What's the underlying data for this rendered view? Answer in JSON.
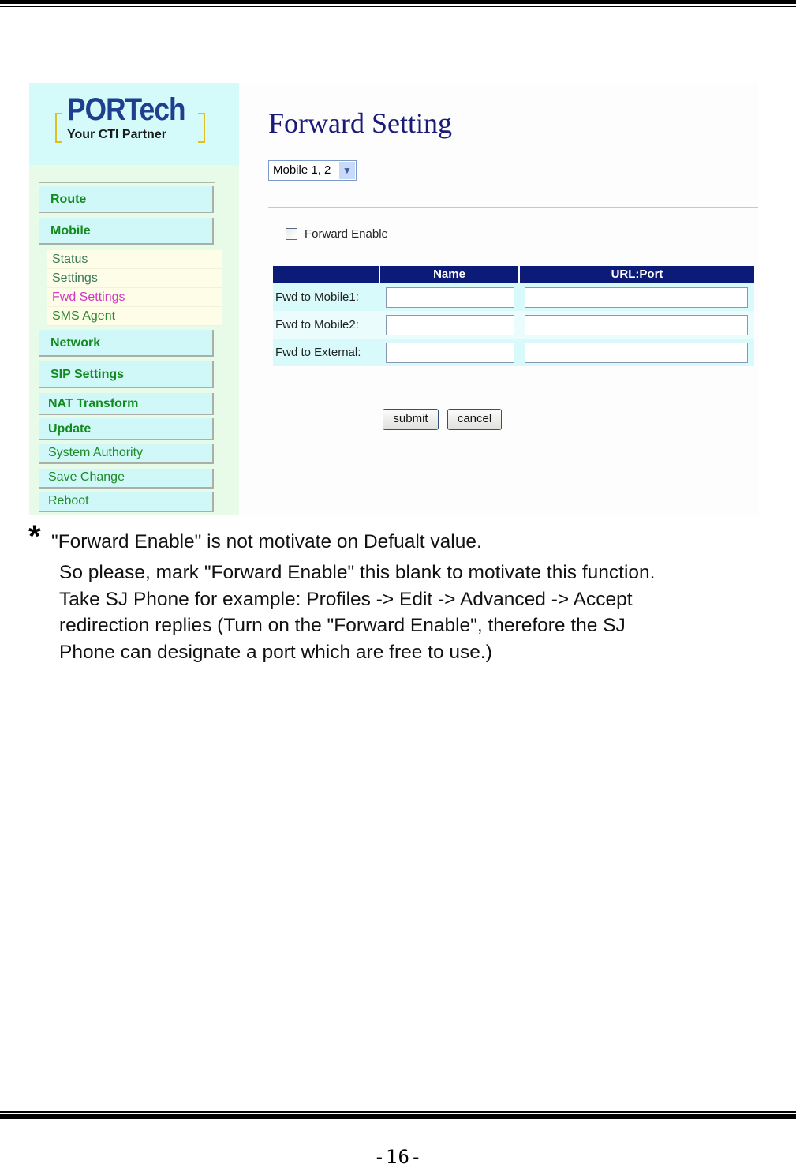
{
  "page": {
    "number": "-16-"
  },
  "screenshot": {
    "logo": {
      "brand": "PORTech",
      "tagline": "Your CTI Partner"
    },
    "sidebar": {
      "items": [
        {
          "label": "Route"
        },
        {
          "label": "Mobile"
        },
        {
          "label": "Network"
        },
        {
          "label": "SIP Settings"
        },
        {
          "label": "NAT Transform"
        },
        {
          "label": "Update"
        },
        {
          "label": "System Authority"
        },
        {
          "label": "Save Change"
        },
        {
          "label": "Reboot"
        }
      ],
      "mobile_submenu": [
        {
          "label": "Status"
        },
        {
          "label": "Settings"
        },
        {
          "label": "Fwd Settings",
          "active": true
        },
        {
          "label": "SMS Agent"
        }
      ]
    },
    "main": {
      "title": "Forward Setting",
      "mobile_select": {
        "selected": "Mobile 1, 2"
      },
      "forward_enable": {
        "label": "Forward Enable",
        "checked": false
      },
      "table": {
        "headers": [
          "",
          "Name",
          "URL:Port"
        ],
        "rows": [
          {
            "label": "Fwd to Mobile1:",
            "name": "",
            "url_port": ""
          },
          {
            "label": "Fwd to Mobile2:",
            "name": "",
            "url_port": ""
          },
          {
            "label": "Fwd to External:",
            "name": "",
            "url_port": ""
          }
        ]
      },
      "buttons": {
        "submit": "submit",
        "cancel": "cancel"
      }
    }
  },
  "note": {
    "bullet": "*",
    "first_line": "\"Forward Enable\" is not motivate on Defualt value.",
    "lines": [
      "So please, mark \"Forward Enable\" this blank to motivate this function.",
      "Take SJ Phone for example: Profiles -> Edit -> Advanced -> Accept",
      "redirection replies (Turn on the \"Forward Enable\", therefore the SJ",
      "Phone can designate a port which are free to use.)"
    ]
  },
  "colors": {
    "header_bg": "#0c1a78",
    "title": "#1a1a78",
    "nav_text": "#138a20",
    "active_submenu": "#d038c0",
    "logo_bg": "#d4fafa",
    "sidebar_bg": "#e8fbe8"
  }
}
